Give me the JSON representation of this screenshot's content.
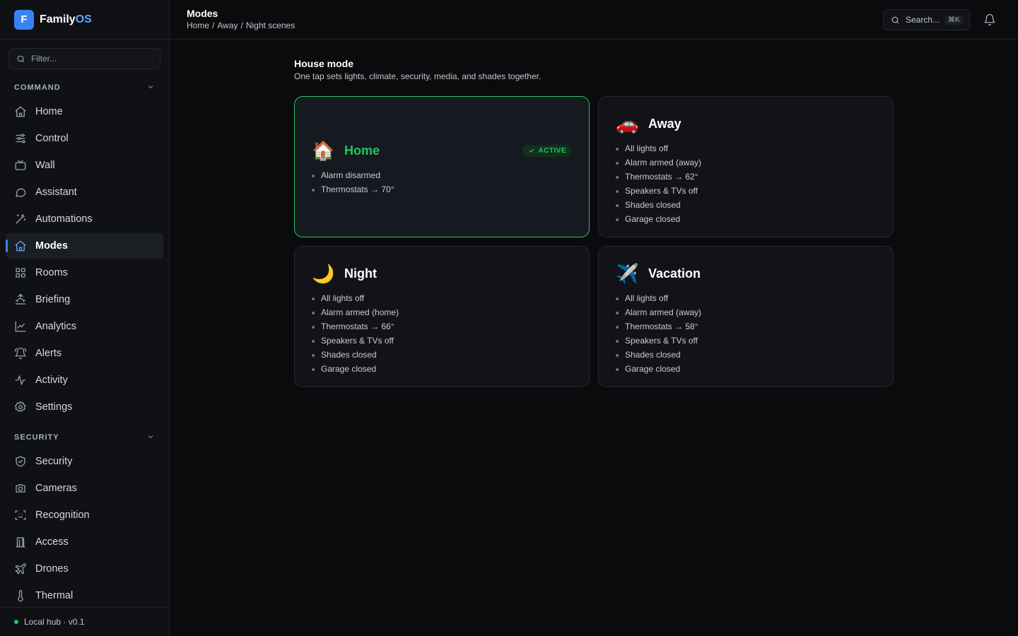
{
  "brand": {
    "logo_letter": "F",
    "name_main": "Family",
    "name_accent": "OS"
  },
  "filter": {
    "placeholder": "Filter..."
  },
  "sections": [
    {
      "title": "COMMAND",
      "items": [
        {
          "label": "Home",
          "icon": "home-icon"
        },
        {
          "label": "Control",
          "icon": "sliders-icon"
        },
        {
          "label": "Wall",
          "icon": "tv-icon"
        },
        {
          "label": "Assistant",
          "icon": "chat-icon"
        },
        {
          "label": "Automations",
          "icon": "wand-icon"
        },
        {
          "label": "Modes",
          "icon": "home-icon",
          "active": true
        },
        {
          "label": "Rooms",
          "icon": "grid-icon"
        },
        {
          "label": "Briefing",
          "icon": "sunrise-icon"
        },
        {
          "label": "Analytics",
          "icon": "chart-icon"
        },
        {
          "label": "Alerts",
          "icon": "bell-ring-icon"
        },
        {
          "label": "Activity",
          "icon": "pulse-icon"
        },
        {
          "label": "Settings",
          "icon": "gear-icon"
        }
      ]
    },
    {
      "title": "SECURITY",
      "items": [
        {
          "label": "Security",
          "icon": "shield-icon"
        },
        {
          "label": "Cameras",
          "icon": "camera-icon"
        },
        {
          "label": "Recognition",
          "icon": "scan-face-icon"
        },
        {
          "label": "Access",
          "icon": "door-icon"
        },
        {
          "label": "Drones",
          "icon": "plane-icon"
        },
        {
          "label": "Thermal",
          "icon": "thermometer-icon"
        }
      ]
    }
  ],
  "footer": {
    "status": "Local hub · v0.1",
    "status_color": "#22c55e"
  },
  "topbar": {
    "title": "Modes",
    "breadcrumb": [
      "Home",
      "/",
      "Away",
      "/",
      "Night scenes"
    ],
    "search_label": "Search...",
    "search_shortcut": "⌘K"
  },
  "main": {
    "title": "House mode",
    "subtitle": "One tap sets lights, climate, security, media, and shades together."
  },
  "modes": [
    {
      "name": "Home",
      "emoji": "🏠",
      "active": true,
      "badge": "ACTIVE",
      "items": [
        "Alarm disarmed",
        "Thermostats → 70°"
      ]
    },
    {
      "name": "Away",
      "emoji": "🚗",
      "active": false,
      "items": [
        "All lights off",
        "Alarm armed (away)",
        "Thermostats → 62°",
        "Speakers & TVs off",
        "Shades closed",
        "Garage closed"
      ]
    },
    {
      "name": "Night",
      "emoji": "🌙",
      "active": false,
      "items": [
        "All lights off",
        "Alarm armed (home)",
        "Thermostats → 66°",
        "Speakers & TVs off",
        "Shades closed",
        "Garage closed"
      ]
    },
    {
      "name": "Vacation",
      "emoji": "✈️",
      "active": false,
      "items": [
        "All lights off",
        "Alarm armed (away)",
        "Thermostats → 58°",
        "Speakers & TVs off",
        "Shades closed",
        "Garage closed"
      ]
    }
  ],
  "colors": {
    "accent": "#3b82f6",
    "active": "#22c55e",
    "background": "#0a0b0d"
  }
}
